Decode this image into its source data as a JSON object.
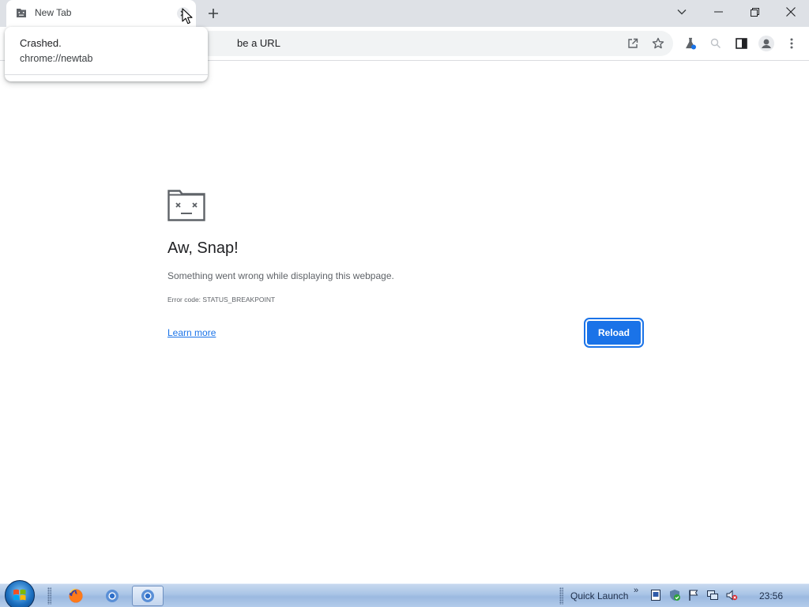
{
  "tab": {
    "title": "New Tab",
    "favicon": "sad-tab-icon",
    "close": "close-icon"
  },
  "tabstrip": {
    "new_tab": "plus-icon",
    "tab_search": "chevron-down-icon",
    "minimize": "minimize-icon",
    "restore": "restore-icon",
    "close_window": "close-window-icon"
  },
  "hovercard": {
    "title": "Crashed.",
    "url": "chrome://newtab"
  },
  "omnibox": {
    "visible_text": "be a URL",
    "placeholder": "Search Google or type a URL"
  },
  "toolbar_icons": [
    "share-icon",
    "bookmark-star-icon",
    "labs-flask-icon",
    "zoom-icon",
    "side-panel-icon",
    "profile-avatar-icon",
    "menu-dots-icon"
  ],
  "error_page": {
    "heading": "Aw, Snap!",
    "message": "Something went wrong while displaying this webpage.",
    "error_code": "Error code: STATUS_BREAKPOINT",
    "learn_more": "Learn more",
    "reload": "Reload"
  },
  "taskbar": {
    "start": "windows-start-icon",
    "apps": [
      "firefox-icon",
      "chrome-icon",
      "chrome-icon"
    ],
    "quick_launch": "Quick Launch",
    "tray_icons": [
      "document-icon",
      "security-shield-icon",
      "action-center-flag-icon",
      "network-icon",
      "volume-muted-icon"
    ],
    "clock": "23:56"
  },
  "colors": {
    "accent": "#1a73e8",
    "tabstrip_bg": "#dee1e6",
    "omnibox_bg": "#f1f3f4",
    "text_primary": "#202124",
    "text_secondary": "#5f6368"
  }
}
